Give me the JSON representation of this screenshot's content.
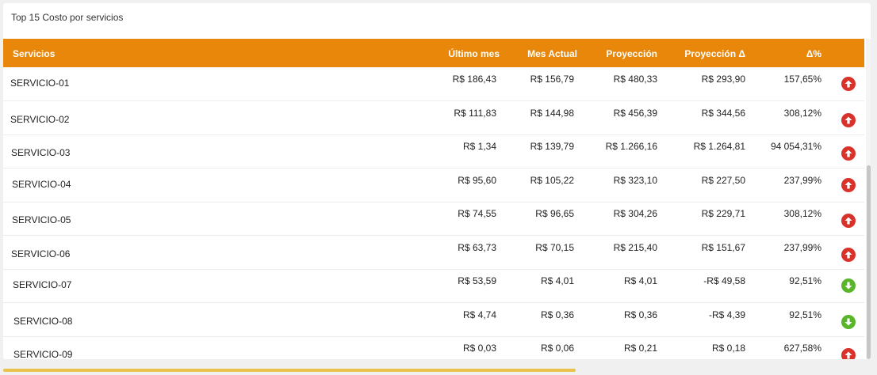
{
  "card": {
    "title": "Top 15 Costo por servicios"
  },
  "table": {
    "headers": {
      "servicios": "Servicios",
      "ultimo_mes": "Último mes",
      "mes_actual": "Mes Actual",
      "proyeccion": "Proyección",
      "proyeccion_delta": "Proyección Δ",
      "delta_pct": "Δ%"
    },
    "rows": [
      {
        "name": "SERVICIO-01",
        "ultimo_mes": "R$ 186,43",
        "mes_actual": "R$ 156,79",
        "proyeccion": "R$ 480,33",
        "proyeccion_delta": "R$ 293,90",
        "delta_pct": "157,65%",
        "trend": "up"
      },
      {
        "name": "SERVICIO-02",
        "ultimo_mes": "R$ 111,83",
        "mes_actual": "R$ 144,98",
        "proyeccion": "R$ 456,39",
        "proyeccion_delta": "R$ 344,56",
        "delta_pct": "308,12%",
        "trend": "up"
      },
      {
        "name": "SERVICIO-03",
        "ultimo_mes": "R$ 1,34",
        "mes_actual": "R$ 139,79",
        "proyeccion": "R$ 1.266,16",
        "proyeccion_delta": "R$ 1.264,81",
        "delta_pct": "94 054,31%",
        "trend": "up"
      },
      {
        "name": "SERVICIO-04",
        "ultimo_mes": "R$ 95,60",
        "mes_actual": "R$ 105,22",
        "proyeccion": "R$ 323,10",
        "proyeccion_delta": "R$ 227,50",
        "delta_pct": "237,99%",
        "trend": "up"
      },
      {
        "name": "SERVICIO-05",
        "ultimo_mes": "R$ 74,55",
        "mes_actual": "R$ 96,65",
        "proyeccion": "R$ 304,26",
        "proyeccion_delta": "R$ 229,71",
        "delta_pct": "308,12%",
        "trend": "up"
      },
      {
        "name": "SERVICIO-06",
        "ultimo_mes": "R$ 63,73",
        "mes_actual": "R$ 70,15",
        "proyeccion": "R$ 215,40",
        "proyeccion_delta": "R$ 151,67",
        "delta_pct": "237,99%",
        "trend": "up"
      },
      {
        "name": "SERVICIO-07",
        "ultimo_mes": "R$ 53,59",
        "mes_actual": "R$ 4,01",
        "proyeccion": "R$ 4,01",
        "proyeccion_delta": "-R$ 49,58",
        "delta_pct": "92,51%",
        "trend": "down"
      },
      {
        "name": "SERVICIO-08",
        "ultimo_mes": "R$ 4,74",
        "mes_actual": "R$ 0,36",
        "proyeccion": "R$ 0,36",
        "proyeccion_delta": "-R$ 4,39",
        "delta_pct": "92,51%",
        "trend": "down"
      },
      {
        "name": "SERVICIO-09",
        "ultimo_mes": "R$ 0,03",
        "mes_actual": "R$ 0,06",
        "proyeccion": "R$ 0,21",
        "proyeccion_delta": "R$ 0,18",
        "delta_pct": "627,58%",
        "trend": "up"
      }
    ]
  },
  "colors": {
    "header_bg": "#e8870a",
    "trend_up": "#d9322b",
    "trend_down": "#5bb52a"
  },
  "icons": {
    "up": "arrow-up-circle-icon",
    "down": "arrow-down-circle-icon"
  }
}
